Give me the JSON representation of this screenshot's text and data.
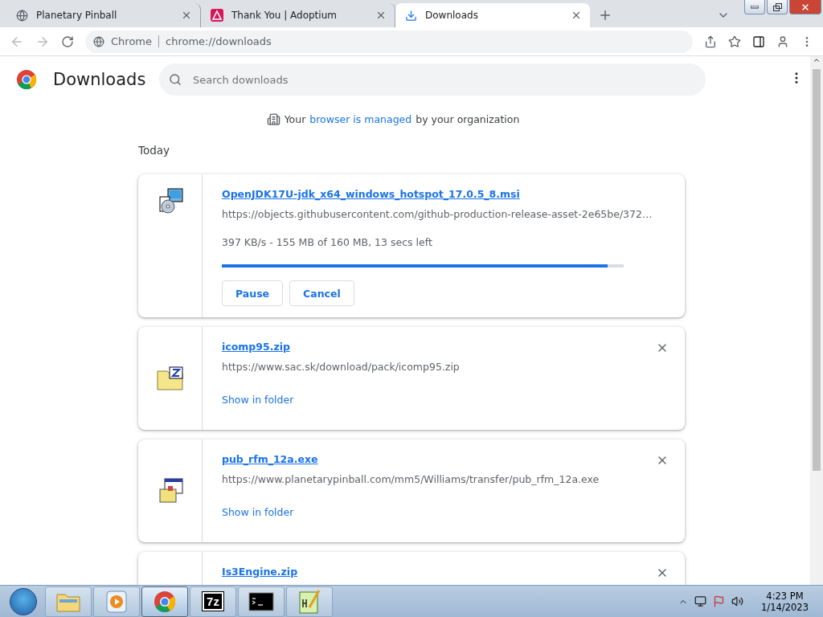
{
  "tabs": [
    {
      "title": "Planetary Pinball",
      "kind": "site",
      "selected": false
    },
    {
      "title": "Thank You | Adoptium",
      "kind": "adoptium",
      "selected": false
    },
    {
      "title": "Downloads",
      "kind": "downloads",
      "selected": true
    }
  ],
  "address_bar": {
    "site_label": "Chrome",
    "url": "chrome://downloads"
  },
  "page": {
    "title": "Downloads",
    "search": {
      "placeholder": "Search downloads"
    },
    "managed_note": {
      "before": "Your",
      "link": "browser is managed",
      "after": "by your organization"
    },
    "section": "Today"
  },
  "downloads": [
    {
      "kind": "in_progress",
      "file_name": "OpenJDK17U-jdk_x64_windows_hotspot_17.0.5_8.msi",
      "url": "https://objects.githubusercontent.com/github-production-release-asset-2e65be/372…",
      "status": "397 KB/s - 155 MB of 160 MB, 13 secs left",
      "level": 0.96,
      "buttons": [
        "Pause",
        "Cancel"
      ]
    },
    {
      "kind": "complete",
      "file_name": "icomp95.zip",
      "url": "https://www.sac.sk/download/pack/icomp95.zip",
      "link": "Show in folder"
    },
    {
      "kind": "complete",
      "file_name": "pub_rfm_12a.exe",
      "url": "https://www.planetarypinball.com/mm5/Williams/transfer/pub_rfm_12a.exe",
      "link": "Show in folder"
    },
    {
      "kind": "complete",
      "file_name": "Is3Engine.zip"
    }
  ],
  "taskbar": {
    "items": [
      {
        "kind": "explorer",
        "selected": false
      },
      {
        "kind": "media",
        "selected": false
      },
      {
        "kind": "chrome",
        "selected": true
      },
      {
        "kind": "archiver",
        "label": "7z",
        "selected": false
      },
      {
        "kind": "console",
        "selected": false
      },
      {
        "kind": "notepad",
        "selected": false
      }
    ],
    "time": "4:23 PM",
    "date": "1/14/2023"
  }
}
